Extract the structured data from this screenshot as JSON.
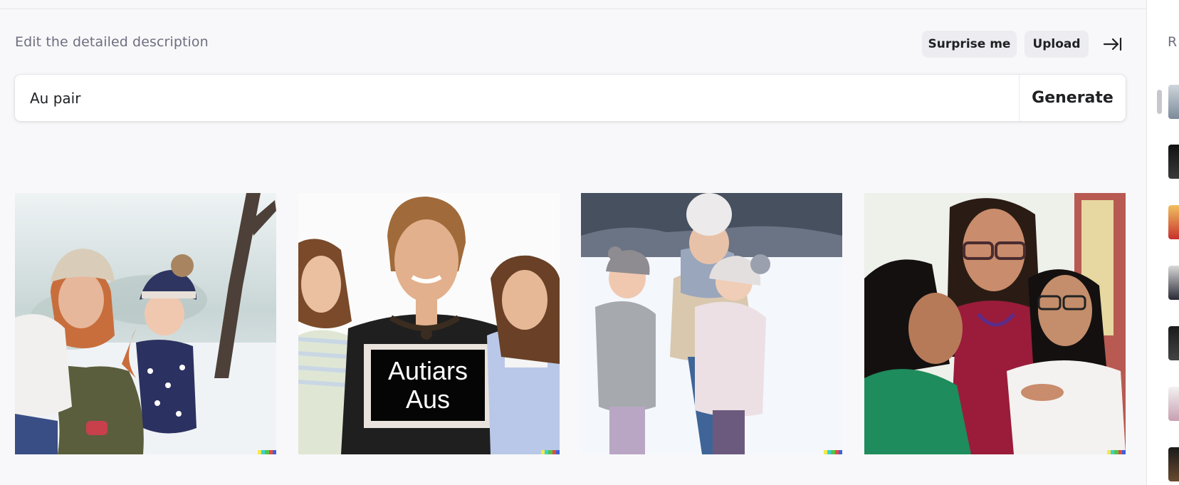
{
  "header": {
    "description_label": "Edit the detailed description",
    "surprise_label": "Surprise me",
    "upload_label": "Upload"
  },
  "prompt": {
    "value": "Au pair",
    "generate_label": "Generate"
  },
  "results": [
    {
      "name": "result-image-1",
      "subject": "woman and two children in winter hats in snowy park"
    },
    {
      "name": "result-image-2",
      "subject": "woman with two girls holding sign",
      "sign_text": [
        "Autiars",
        "Aus"
      ]
    },
    {
      "name": "result-image-3",
      "subject": "woman hugging two children in snow"
    },
    {
      "name": "result-image-4",
      "subject": "woman with glasses hugging two girls"
    }
  ],
  "sidebar": {
    "heading": "R"
  },
  "colors": {
    "background": "#f8f8fa",
    "pill": "#ececf1",
    "text": "#202123",
    "muted": "#6e6e80"
  }
}
